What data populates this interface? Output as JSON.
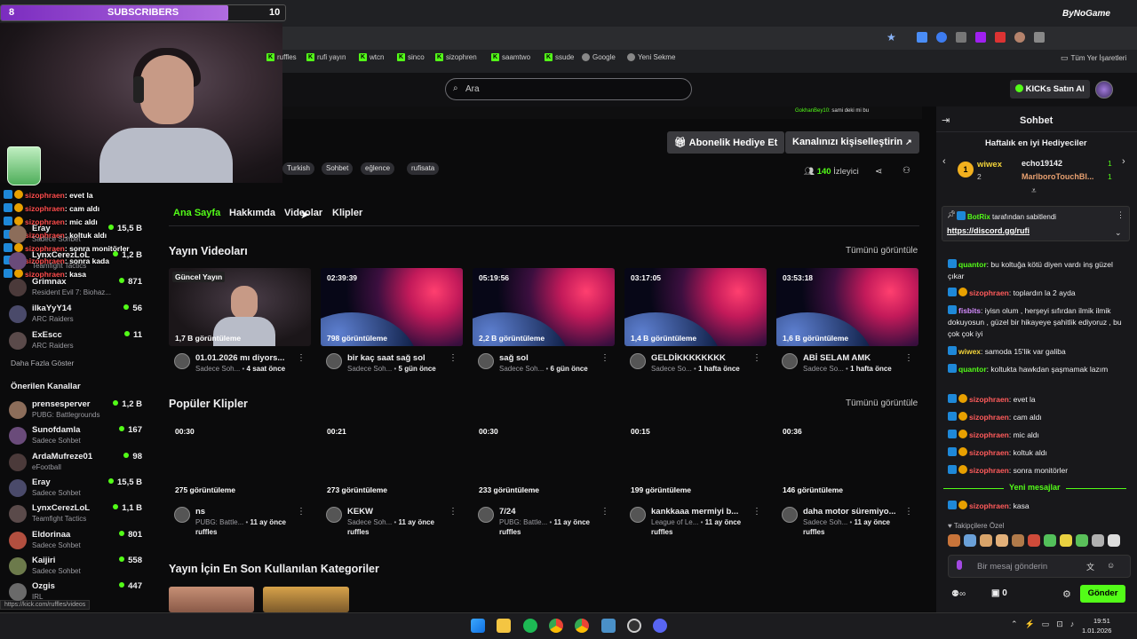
{
  "overlay": {
    "sub_count_left": "8",
    "sub_label": "SUBSCRIBERS",
    "sub_goal": "10",
    "sub_progress": 0.8,
    "sponsor": "ByNoGame"
  },
  "browser": {
    "bookmarks": [
      "ruffles",
      "rufi yayın",
      "wtcn",
      "sinco",
      "sizophren",
      "saamtwo",
      "ssude",
      "Google",
      "Yeni Sekme"
    ],
    "all_bookmarks": "Tüm Yer İşaretleri",
    "status_url": "https://kick.com/ruffles/videos"
  },
  "header": {
    "search_placeholder": "Ara",
    "kicks_button": "KICKs Satın Al"
  },
  "banner_chat_preview": "sami deki mi bu",
  "channel": {
    "tags": [
      "Turkish",
      "Sohbet",
      "eğlence",
      "rufisata"
    ],
    "gift_sub_button": "Abonelik Hediye Et",
    "customize_button": "Kanalınızı kişiselleştirin",
    "viewers": "140",
    "viewers_label": "İzleyici"
  },
  "tabs": [
    "Ana Sayfa",
    "Hakkımda",
    "Videolar",
    "Klipler"
  ],
  "stream_videos": {
    "title": "Yayın Videoları",
    "see_all": "Tümünü görüntüle",
    "items": [
      {
        "badge": "Güncel Yayın",
        "views": "1,7 B görüntüleme",
        "title": "01.01.2026 mı diyors...",
        "cat": "Sadece Soh...",
        "when": "4 saat önce"
      },
      {
        "badge": "02:39:39",
        "views": "798 görüntüleme",
        "title": "bir kaç saat sağ sol",
        "cat": "Sadece Soh...",
        "when": "5 gün önce"
      },
      {
        "badge": "05:19:56",
        "views": "2,2 B görüntüleme",
        "title": "sağ sol",
        "cat": "Sadece Soh...",
        "when": "6 gün önce"
      },
      {
        "badge": "03:17:05",
        "views": "1,4 B görüntüleme",
        "title": "GELDİKKKKKKKK",
        "cat": "Sadece So...",
        "when": "1 hafta önce"
      },
      {
        "badge": "03:53:18",
        "views": "1,6 B görüntüleme",
        "title": "ABİ SELAM AMK",
        "cat": "Sadece So...",
        "when": "1 hafta önce"
      }
    ]
  },
  "popular_clips": {
    "title": "Popüler Klipler",
    "see_all": "Tümünü görüntüle",
    "items": [
      {
        "dur": "00:30",
        "views": "275 görüntüleme",
        "title": "ns",
        "cat": "PUBG: Battle...",
        "when": "11 ay önce",
        "channel": "ruffles"
      },
      {
        "dur": "00:21",
        "views": "273 görüntüleme",
        "title": "KEKW",
        "cat": "Sadece Soh...",
        "when": "11 ay önce",
        "channel": "ruffles"
      },
      {
        "dur": "00:30",
        "views": "233 görüntüleme",
        "title": "7/24",
        "cat": "PUBG: Battle...",
        "when": "11 ay önce",
        "channel": "ruffles"
      },
      {
        "dur": "00:15",
        "views": "199 görüntüleme",
        "title": "kankkaaa mermiyi b...",
        "cat": "League of Le...",
        "when": "11 ay önce",
        "channel": "ruffles"
      },
      {
        "dur": "00:36",
        "views": "146 görüntüleme",
        "title": "daha motor süremiyo...",
        "cat": "Sadece Soh...",
        "when": "11 ay önce",
        "channel": "ruffles"
      }
    ]
  },
  "recent_categories_title": "Yayın İçin En Son Kullanılan Kategoriler",
  "sidebar": {
    "followed": [
      {
        "name": "Eray",
        "cat": "Sadece Sohbet",
        "viewers": "15,5 B"
      },
      {
        "name": "LynxCerezLoL",
        "cat": "Teamfight Tactics",
        "viewers": "1,2 B"
      },
      {
        "name": "Grimnax",
        "cat": "Resident Evil 7: Biohaz...",
        "viewers": "871"
      },
      {
        "name": "ilkaYyY14",
        "cat": "ARC Raiders",
        "viewers": "56"
      },
      {
        "name": "ExEscc",
        "cat": "ARC Raiders",
        "viewers": "11"
      }
    ],
    "show_more": "Daha Fazla Göster",
    "recommended_title": "Önerilen Kanallar",
    "recommended": [
      {
        "name": "prensesperver",
        "cat": "PUBG: Battlegrounds",
        "viewers": "1,2 B"
      },
      {
        "name": "Sunofdamla",
        "cat": "Sadece Sohbet",
        "viewers": "167"
      },
      {
        "name": "ArdaMufreze01",
        "cat": "eFootball",
        "viewers": "98"
      },
      {
        "name": "Eray",
        "cat": "Sadece Sohbet",
        "viewers": "15,5 B"
      },
      {
        "name": "LynxCerezLoL",
        "cat": "Teamfight Tactics",
        "viewers": "1,1 B"
      },
      {
        "name": "Eldorinaa",
        "cat": "Sadece Sohbet",
        "viewers": "801"
      },
      {
        "name": "Kaijiri",
        "cat": "Sadece Sohbet",
        "viewers": "558"
      },
      {
        "name": "Ozgis",
        "cat": "IRL",
        "viewers": "447"
      }
    ]
  },
  "stream_overlay_chat": [
    {
      "user": "sizophraen",
      "msg": "evet la"
    },
    {
      "user": "sizophraen",
      "msg": "cam aldı"
    },
    {
      "user": "sizophraen",
      "msg": "mic aldı"
    },
    {
      "user": "sizophraen",
      "msg": "koltuk aldı"
    },
    {
      "user": "sizophraen",
      "msg": "sonra monitörler"
    },
    {
      "user": "sizophraen",
      "msg": "sonra kada"
    },
    {
      "user": "sizophraen",
      "msg": "kasa"
    }
  ],
  "chat": {
    "title": "Sohbet",
    "top_gifters_title": "Haftalık en iyi Hediyeciler",
    "gifters": [
      {
        "rank": "1",
        "name": "wiwex",
        "count": "2"
      },
      {
        "name": "echo19142",
        "count": "1"
      },
      {
        "name": "MarlboroTouchBl...",
        "count": "1"
      }
    ],
    "pinned_by": "BotRix",
    "pinned_label": "tarafından sabitlendi",
    "pinned_link": "https://discord.gg/rufi",
    "messages": [
      {
        "user": "quantor",
        "cls": "g",
        "text": "bu koltuğa kötü diyen vardı inş güzel çıkar"
      },
      {
        "user": "sizophraen",
        "cls": "n",
        "text": "toplardın la 2 ayda"
      },
      {
        "user": "fisbits",
        "cls": "p",
        "text": "iyisn olum , herşeyi sıfırdan ilmik ilmik dokuyosun , güzel bir hikayeye şahitlik ediyoruz , bu çok çok iyi"
      },
      {
        "user": "wiwex",
        "cls": "y",
        "text": "samoda 15'lik var galiba"
      },
      {
        "user": "quantor",
        "cls": "g",
        "text": "koltukta hawkdan şaşmamak lazım"
      },
      {
        "user": "sizophraen",
        "cls": "n",
        "text": "evet la"
      },
      {
        "user": "sizophraen",
        "cls": "n",
        "text": "cam aldı"
      },
      {
        "user": "sizophraen",
        "cls": "n",
        "text": "mic aldı"
      },
      {
        "user": "sizophraen",
        "cls": "n",
        "text": "koltuk aldı"
      },
      {
        "user": "sizophraen",
        "cls": "n",
        "text": "sonra monitörler"
      }
    ],
    "new_messages": "Yeni mesajlar",
    "last_message": {
      "user": "sizophraen",
      "text": "kasa"
    },
    "followers_emotes": "Takipçilere Özel",
    "input_placeholder": "Bir mesaj gönderin",
    "send": "Gönder",
    "kicks_count": "0"
  },
  "taskbar": {
    "time": "19:51",
    "date": "1.01.2026"
  },
  "colors": {
    "kick_green": "#53fc18",
    "bg": "#0b0b0c",
    "panel": "#18181b",
    "sub_purple": "#9d4edd"
  }
}
